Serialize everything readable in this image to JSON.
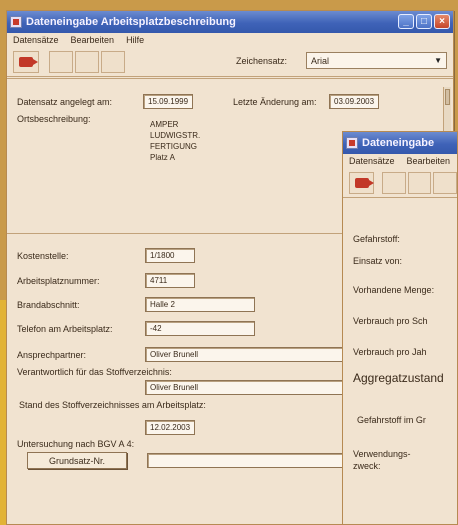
{
  "main": {
    "title": "Dateneingabe Arbeitsplatzbeschreibung",
    "menu": [
      "Datensätze",
      "Bearbeiten",
      "Hilfe"
    ],
    "toolbar": {
      "font_label": "Zeichensatz:",
      "font_value": "Arial"
    },
    "header": {
      "created_label": "Datensatz angelegt am:",
      "created_value": "15.09.1999",
      "changed_label": "Letzte Änderung am:",
      "changed_value": "03.09.2003",
      "location_label": "Ortsbeschreibung:",
      "location_lines": [
        "AMPER",
        "LUDWIGSTR.",
        "FERTIGUNG",
        "Platz A"
      ]
    },
    "fields": {
      "kostenstelle_label": "Kostenstelle:",
      "kostenstelle_value": "1/1800",
      "arbeitsplatz_label": "Arbeitsplatznummer:",
      "arbeitsplatz_value": "4711",
      "brandabschnitt_label": "Brandabschnitt:",
      "brandabschnitt_value": "Halle 2",
      "telefon_label": "Telefon am Arbeitsplatz:",
      "telefon_value": "-42",
      "ansprech_label": "Ansprechpartner:",
      "ansprech_value": "Oliver Brunell",
      "verantw_label": "Verantwortlich für das Stoffverzeichnis:",
      "verantw_value": "Oliver Brunell",
      "stand_label": "Stand des Stoffverzeichnisses am Arbeitsplatz:",
      "stand_value": "12.02.2003",
      "untersuchung_label": "Untersuchung nach BGV A 4:",
      "grundsatz_button": "Grundsatz-Nr."
    }
  },
  "second": {
    "title": "Dateneingabe",
    "menu": [
      "Datensätze",
      "Bearbeiten"
    ],
    "labels": [
      "Gefahrstoff:",
      "Einsatz von:",
      "Vorhandene Menge:",
      "Verbrauch pro Sch",
      "Verbrauch pro Jah",
      "Aggregatzustand",
      "Gefahrstoff im Gr",
      "Verwendungs-",
      "zweck:"
    ]
  }
}
